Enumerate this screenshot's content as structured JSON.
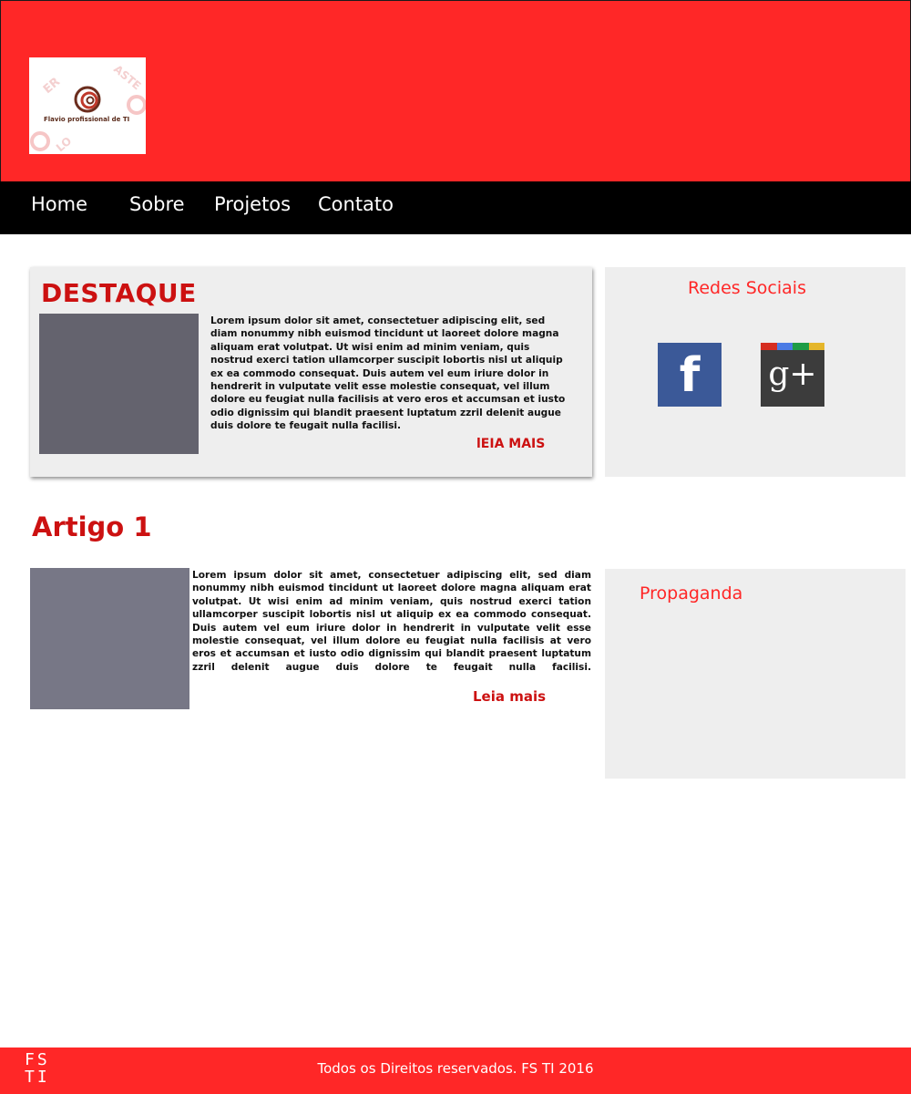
{
  "header": {
    "logo_caption": "Flavio profissional de TI",
    "colors": {
      "header_bg": "#ff2727",
      "nav_bg": "#000000",
      "accent": "#cc1111"
    }
  },
  "nav": {
    "items": [
      {
        "label": "Home"
      },
      {
        "label": "Sobre"
      },
      {
        "label": "Projetos"
      },
      {
        "label": "Contato"
      }
    ]
  },
  "destaque": {
    "title": "DESTAQUE",
    "text": "Lorem ipsum dolor sit amet, consectetuer adipiscing elit, sed diam nonummy nibh euismod tincidunt ut laoreet dolore magna aliquam erat volutpat. Ut wisi enim ad minim veniam, quis nostrud exerci tation ullamcorper suscipit lobortis nisl ut aliquip ex ea commodo consequat. Duis autem vel eum iriure dolor in hendrerit in vulputate velit esse molestie consequat, vel illum dolore eu feugiat nulla facilisis at vero eros et accumsan et iusto odio dignissim qui blandit praesent luptatum zzril delenit augue duis dolore te feugait nulla facilisi.",
    "more_label": "lEIA MAIS"
  },
  "redes": {
    "title": "Redes Sociais",
    "icons": [
      "facebook-icon",
      "google-plus-icon"
    ],
    "fb_glyph": "f",
    "gp_glyph": "g+"
  },
  "artigo": {
    "title": "Artigo 1",
    "text": "Lorem ipsum dolor sit amet, consectetuer adipiscing elit, sed diam nonummy nibh euismod tincidunt ut laoreet dolore magna aliquam erat volutpat. Ut wisi enim ad minim veniam, quis nostrud exerci tation ullamcorper suscipit lobortis nisl ut aliquip ex ea commodo consequat. Duis autem vel eum iriure dolor in hendrerit in vulputate velit esse molestie consequat, vel illum dolore eu feugiat nulla facilisis at vero eros et accumsan et iusto odio dignissim qui blandit praesent luptatum zzril delenit augue duis dolore te feugait nulla facilisi.",
    "more_label": "Leia mais"
  },
  "propaganda": {
    "title": "Propaganda"
  },
  "footer": {
    "logo_line1": "FS",
    "logo_line2": "TI",
    "text": "Todos os Direitos reservados. FS TI 2016"
  }
}
